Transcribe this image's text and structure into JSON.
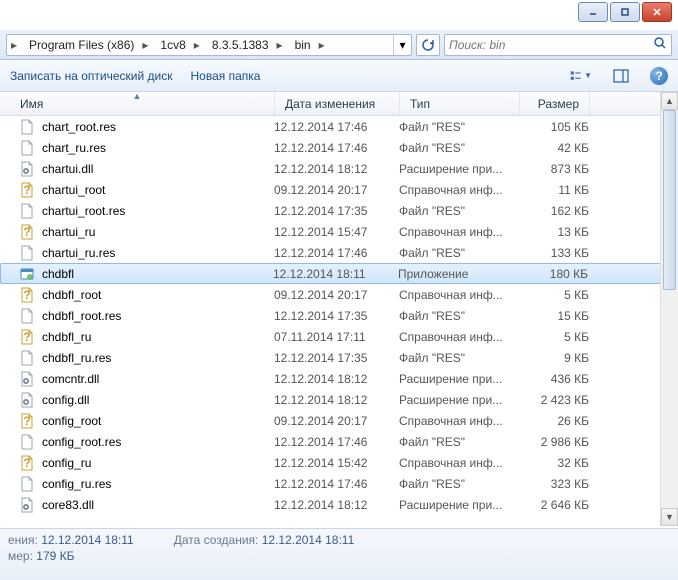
{
  "breadcrumb": [
    "Program Files (x86)",
    "1cv8",
    "8.3.5.1383",
    "bin"
  ],
  "search": {
    "placeholder": "Поиск: bin"
  },
  "toolbar": {
    "burn": "Записать на оптический диск",
    "new_folder": "Новая папка"
  },
  "columns": {
    "name": "Имя",
    "date": "Дата изменения",
    "type": "Тип",
    "size": "Размер"
  },
  "status": {
    "modified_label": "ения:",
    "modified_value": "12.12.2014 18:11",
    "size_label": "мер:",
    "size_value": "179 КБ",
    "created_label": "Дата создания:",
    "created_value": "12.12.2014 18:11"
  },
  "sel_index": 8,
  "rows": [
    {
      "icon": "doc",
      "name": "chart_root.res",
      "date": "12.12.2014 17:46",
      "type": "Файл \"RES\"",
      "size": "105 КБ"
    },
    {
      "icon": "doc",
      "name": "chart_ru.res",
      "date": "12.12.2014 17:46",
      "type": "Файл \"RES\"",
      "size": "42 КБ"
    },
    {
      "icon": "dll",
      "name": "chartui.dll",
      "date": "12.12.2014 18:12",
      "type": "Расширение при...",
      "size": "873 КБ"
    },
    {
      "icon": "help",
      "name": "chartui_root",
      "date": "09.12.2014 20:17",
      "type": "Справочная инф...",
      "size": "11 КБ"
    },
    {
      "icon": "doc",
      "name": "chartui_root.res",
      "date": "12.12.2014 17:35",
      "type": "Файл \"RES\"",
      "size": "162 КБ"
    },
    {
      "icon": "help",
      "name": "chartui_ru",
      "date": "12.12.2014 15:47",
      "type": "Справочная инф...",
      "size": "13 КБ"
    },
    {
      "icon": "doc",
      "name": "chartui_ru.res",
      "date": "12.12.2014 17:46",
      "type": "Файл \"RES\"",
      "size": "133 КБ"
    },
    {
      "icon": "app",
      "name": "chdbfl",
      "date": "12.12.2014 18:11",
      "type": "Приложение",
      "size": "180 КБ"
    },
    {
      "icon": "help",
      "name": "chdbfl_root",
      "date": "09.12.2014 20:17",
      "type": "Справочная инф...",
      "size": "5 КБ"
    },
    {
      "icon": "doc",
      "name": "chdbfl_root.res",
      "date": "12.12.2014 17:35",
      "type": "Файл \"RES\"",
      "size": "15 КБ"
    },
    {
      "icon": "help",
      "name": "chdbfl_ru",
      "date": "07.11.2014 17:11",
      "type": "Справочная инф...",
      "size": "5 КБ"
    },
    {
      "icon": "doc",
      "name": "chdbfl_ru.res",
      "date": "12.12.2014 17:35",
      "type": "Файл \"RES\"",
      "size": "9 КБ"
    },
    {
      "icon": "dll",
      "name": "comcntr.dll",
      "date": "12.12.2014 18:12",
      "type": "Расширение при...",
      "size": "436 КБ"
    },
    {
      "icon": "dll",
      "name": "config.dll",
      "date": "12.12.2014 18:12",
      "type": "Расширение при...",
      "size": "2 423 КБ"
    },
    {
      "icon": "help",
      "name": "config_root",
      "date": "09.12.2014 20:17",
      "type": "Справочная инф...",
      "size": "26 КБ"
    },
    {
      "icon": "doc",
      "name": "config_root.res",
      "date": "12.12.2014 17:46",
      "type": "Файл \"RES\"",
      "size": "2 986 КБ"
    },
    {
      "icon": "help",
      "name": "config_ru",
      "date": "12.12.2014 15:42",
      "type": "Справочная инф...",
      "size": "32 КБ"
    },
    {
      "icon": "doc",
      "name": "config_ru.res",
      "date": "12.12.2014 17:46",
      "type": "Файл \"RES\"",
      "size": "323 КБ"
    },
    {
      "icon": "dll",
      "name": "core83.dll",
      "date": "12.12.2014 18:12",
      "type": "Расширение при...",
      "size": "2 646 КБ"
    }
  ]
}
